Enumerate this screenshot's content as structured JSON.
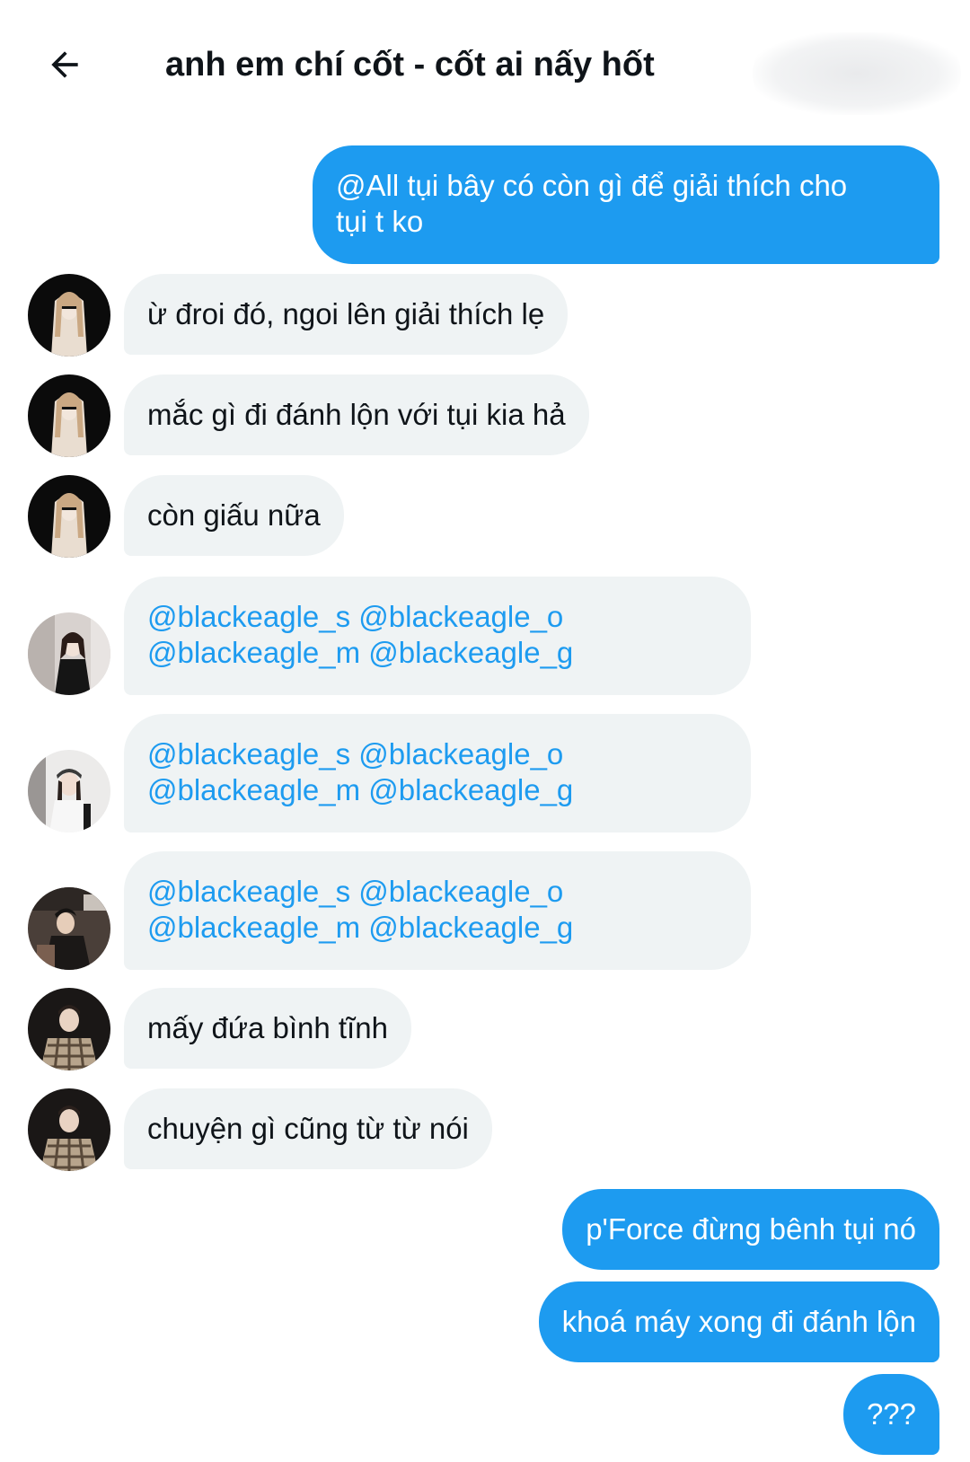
{
  "header": {
    "title": "anh em chí cốt - cốt ai nấy hốt",
    "back_icon": "arrow-left-icon"
  },
  "messages": [
    {
      "direction": "outgoing",
      "lines": [
        "@All tụi bây có còn gì để giải thích cho",
        "tụi t ko"
      ]
    },
    {
      "direction": "incoming",
      "sender_avatar": "avatar-girl-sunglasses",
      "lines": [
        "ừ đroi đó, ngoi lên giải thích lẹ"
      ]
    },
    {
      "direction": "incoming",
      "sender_avatar": "avatar-girl-sunglasses",
      "lines": [
        "mắc gì đi đánh lộn với tụi kia hả"
      ]
    },
    {
      "direction": "incoming",
      "sender_avatar": "avatar-girl-sunglasses",
      "lines": [
        "còn giấu nữa"
      ]
    },
    {
      "direction": "incoming",
      "sender_avatar": "avatar-girl-mirror",
      "lines": [
        "@blackeagle_s @blackeagle_o",
        "@blackeagle_m @blackeagle_g"
      ]
    },
    {
      "direction": "incoming",
      "sender_avatar": "avatar-girl-cap",
      "lines": [
        "@blackeagle_s @blackeagle_o",
        "@blackeagle_m @blackeagle_g"
      ]
    },
    {
      "direction": "incoming",
      "sender_avatar": "avatar-boy-street",
      "lines": [
        "@blackeagle_s @blackeagle_o",
        "@blackeagle_m @blackeagle_g"
      ]
    },
    {
      "direction": "incoming",
      "sender_avatar": "avatar-boy-plaid",
      "lines": [
        "mấy đứa bình tĩnh"
      ]
    },
    {
      "direction": "incoming",
      "sender_avatar": "avatar-boy-plaid",
      "lines": [
        "chuyện gì cũng từ từ nói"
      ]
    },
    {
      "direction": "outgoing",
      "lines": [
        "p'Force đừng bênh tụi nó"
      ]
    },
    {
      "direction": "outgoing",
      "lines": [
        "khoá máy xong đi đánh lộn"
      ]
    },
    {
      "direction": "outgoing",
      "lines": [
        "???"
      ]
    }
  ],
  "colors": {
    "outgoing_bubble": "#1d9bf0",
    "incoming_bubble": "#eff3f4",
    "mention_text": "#1d9bf0",
    "text_primary": "#0f1419"
  }
}
